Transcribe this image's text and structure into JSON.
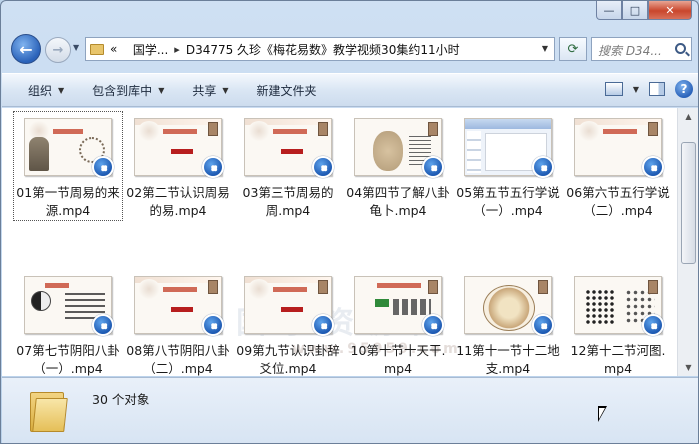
{
  "window": {
    "min_glyph": "—",
    "max_glyph": "□",
    "close_glyph": "✕"
  },
  "address_bar": {
    "back_glyph": "←",
    "forward_glyph": "→",
    "chevron": "«",
    "crumbs": [
      "国学...",
      "D34775 久珍《梅花易数》教学视频30集约11小时"
    ],
    "separator": "▸",
    "refresh_glyph": "⟳",
    "search_placeholder": "搜索 D34..."
  },
  "toolbar": {
    "organize": "组织",
    "include_library": "包含到库中",
    "share": "共享",
    "new_folder": "新建文件夹"
  },
  "files": [
    {
      "name": "01第一节周易的来源.mp4",
      "thumb": "sage",
      "selected": true
    },
    {
      "name": "02第二节认识周易的易.mp4",
      "thumb": "title"
    },
    {
      "name": "03第三节周易的周.mp4",
      "thumb": "title"
    },
    {
      "name": "04第四节了解八卦龟卜.mp4",
      "thumb": "turtle"
    },
    {
      "name": "05第五节五行学说（一）.mp4",
      "thumb": "ppt"
    },
    {
      "name": "06第六节五行学说（二）.mp4",
      "thumb": "title"
    },
    {
      "name": "07第七节阴阳八卦（一）.mp4",
      "thumb": "yinyang"
    },
    {
      "name": "08第八节阴阳八卦（二）.mp4",
      "thumb": "title"
    },
    {
      "name": "09第九节认识卦辞爻位.mp4",
      "thumb": "title"
    },
    {
      "name": "10第十节十天干.mp4",
      "thumb": "stems"
    },
    {
      "name": "11第十一节十二地支.mp4",
      "thumb": "circle"
    },
    {
      "name": "12第十二节河图.mp4",
      "thumb": "hetu"
    }
  ],
  "watermark": {
    "main": "国学资源网",
    "url": "www.95959.com"
  },
  "details": {
    "count": "30 个对象"
  }
}
